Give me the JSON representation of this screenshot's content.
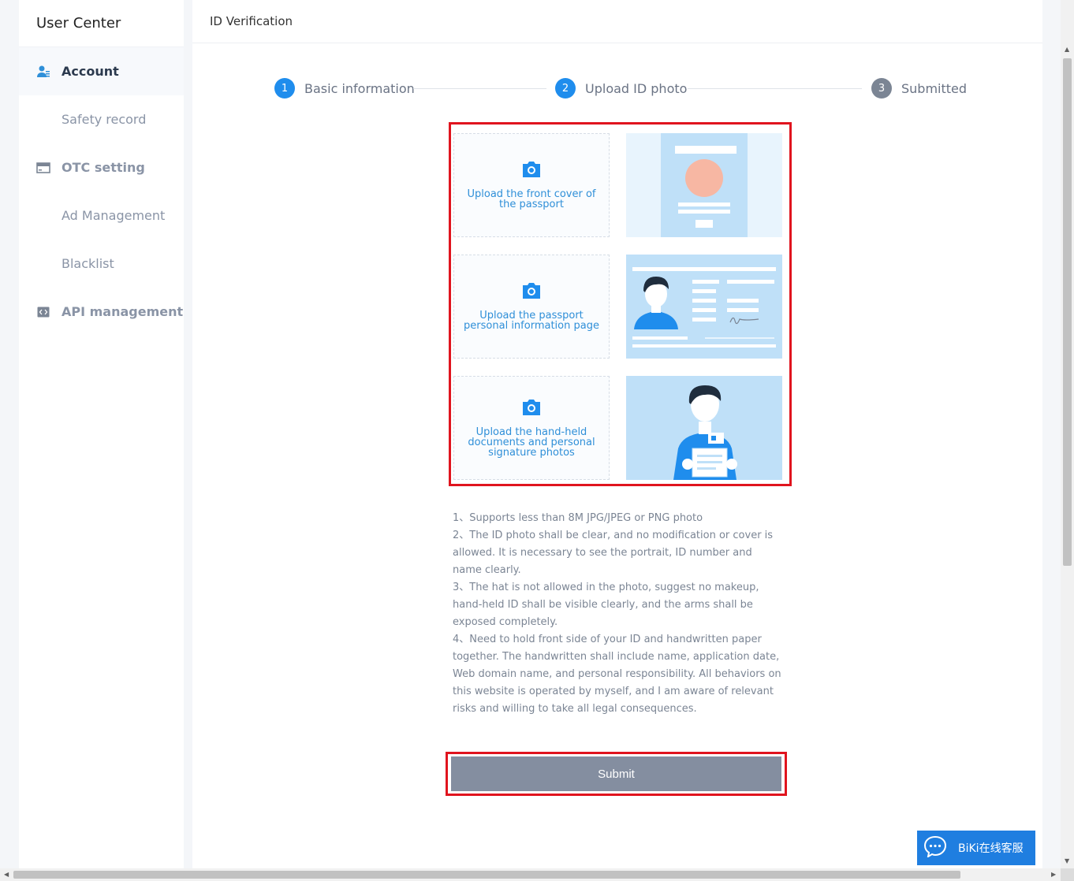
{
  "sidebar": {
    "title": "User Center",
    "items": [
      {
        "label": "Account",
        "icon": "user-icon"
      },
      {
        "label": "Safety record"
      },
      {
        "label": "OTC setting",
        "icon": "card-icon"
      },
      {
        "label": "Ad Management"
      },
      {
        "label": "Blacklist"
      },
      {
        "label": "API management",
        "icon": "code-icon"
      }
    ]
  },
  "page": {
    "title": "ID Verification"
  },
  "steps": [
    {
      "num": "1",
      "label": "Basic information"
    },
    {
      "num": "2",
      "label": "Upload ID photo"
    },
    {
      "num": "3",
      "label": "Submitted"
    }
  ],
  "uploads": [
    {
      "label": "Upload the front cover of the passport",
      "icon": "camera-icon"
    },
    {
      "label": "Upload the passport personal information page",
      "icon": "camera-icon"
    },
    {
      "label": "Upload the hand-held documents and personal signature photos",
      "icon": "camera-icon"
    }
  ],
  "notes": [
    "1、Supports less than 8M JPG/JPEG or PNG photo",
    "2、The ID photo shall be clear, and no modification or cover is allowed. It is necessary to see the portrait, ID number and name clearly.",
    "3、The hat is not allowed in the photo, suggest no makeup, hand-held ID shall be visible clearly, and the arms shall be exposed completely.",
    "4、Need to hold front side of your ID and handwritten paper together. The handwritten shall include name, application date, Web domain name, and personal responsibility. All behaviors on this website is operated by myself, and I am aware of relevant risks and willing to take all legal consequences."
  ],
  "submit": {
    "label": "Submit"
  },
  "chat": {
    "label": "BiKi在线客服",
    "icon": "chat-bubble-icon"
  },
  "colors": {
    "accent": "#1f8ded",
    "highlight": "#e0141e",
    "button": "#848ea0"
  }
}
